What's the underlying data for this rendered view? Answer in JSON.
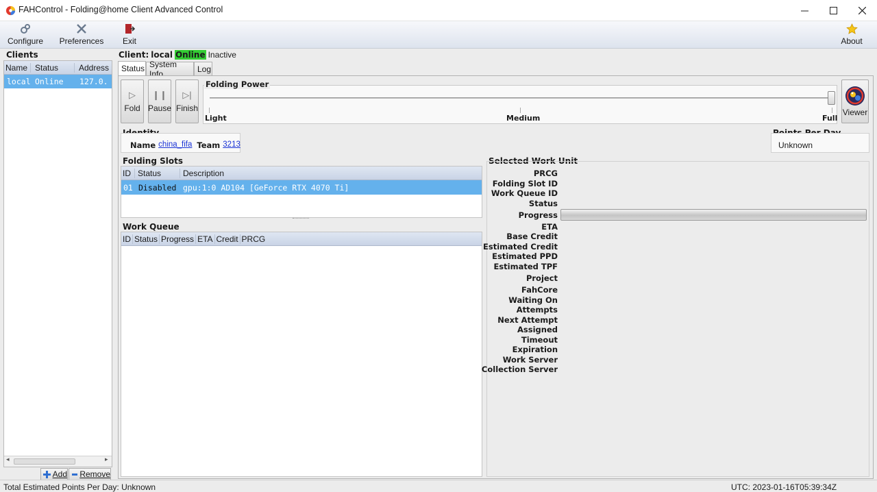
{
  "window": {
    "title": "FAHControl - Folding@home Client Advanced Control"
  },
  "toolbar": {
    "configure": "Configure",
    "preferences": "Preferences",
    "exit": "Exit",
    "about": "About"
  },
  "clients": {
    "heading": "Clients",
    "columns": [
      "Name",
      "Status",
      "Address"
    ],
    "rows": [
      {
        "name": "local",
        "status": "Online",
        "address": "127.0."
      }
    ],
    "add_label": "Add",
    "remove_label": "Remove"
  },
  "client_header": {
    "prefix": "Client:",
    "name": "local",
    "online": "Online",
    "inactive": "Inactive"
  },
  "tabs": [
    "Status",
    "System Info",
    "Log"
  ],
  "controls": {
    "fold": "Fold",
    "pause": "Pause",
    "finish": "Finish",
    "viewer": "Viewer"
  },
  "folding_power": {
    "title": "Folding Power",
    "light": "Light",
    "medium": "Medium",
    "full": "Full",
    "level": 1.0
  },
  "identity": {
    "title": "Identity",
    "name_label": "Name",
    "name_value": "china_fifa",
    "team_label": "Team",
    "team_value": "3213"
  },
  "ppd": {
    "title": "Points Per Day",
    "value": "Unknown"
  },
  "slots": {
    "title": "Folding Slots",
    "columns": [
      "ID",
      "Status",
      "Description"
    ],
    "rows": [
      {
        "id": "01",
        "status": "Disabled",
        "description": "gpu:1:0 AD104 [GeForce RTX 4070 Ti]"
      }
    ]
  },
  "work_queue": {
    "title": "Work Queue",
    "columns": [
      "ID",
      "Status",
      "Progress",
      "ETA",
      "Credit",
      "PRCG"
    ]
  },
  "work_unit": {
    "title": "Selected Work Unit",
    "labels": [
      "PRCG",
      "Folding Slot ID",
      "Work Queue ID",
      "Status",
      "Progress",
      "ETA",
      "Base Credit",
      "Estimated Credit",
      "Estimated PPD",
      "Estimated TPF",
      "Project",
      "FahCore",
      "Waiting On",
      "Attempts",
      "Next Attempt",
      "Assigned",
      "Timeout",
      "Expiration",
      "Work Server",
      "Collection Server"
    ]
  },
  "statusbar": {
    "total_ppd": "Total Estimated Points Per Day: Unknown",
    "utc": "UTC: 2023-01-16T05:39:34Z"
  },
  "colors": {
    "online_badge": "#33cc33",
    "selection": "#64b1ec",
    "link": "#1a33d6"
  }
}
